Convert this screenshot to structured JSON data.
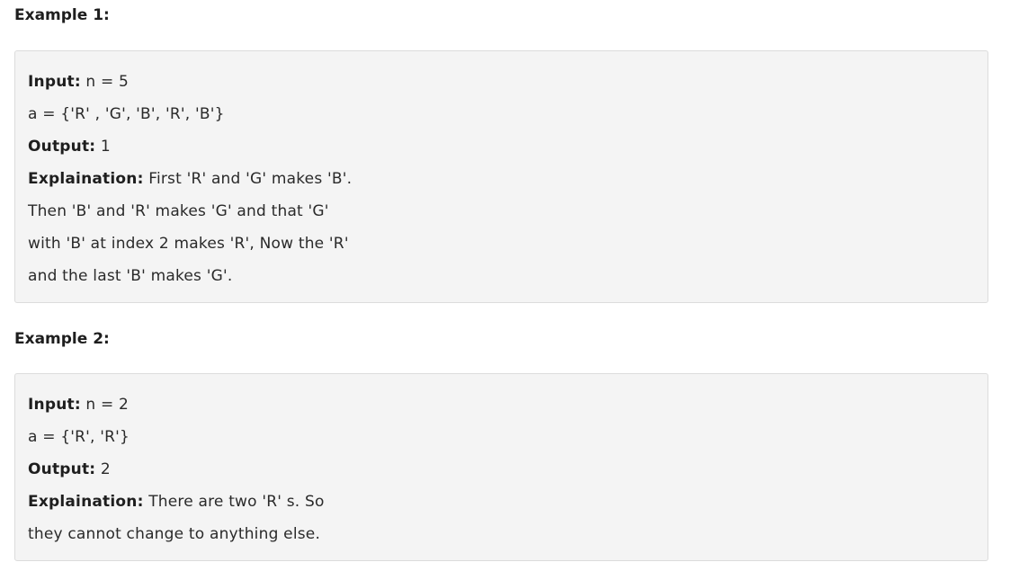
{
  "examples": [
    {
      "heading": "Example 1:",
      "input_label": "Input:",
      "input_value": " n = 5",
      "array_line": "a = {'R' , 'G', 'B', 'R', 'B'}",
      "output_label": "Output:",
      "output_value": " 1",
      "explanation_label": "Explaination:",
      "explanation_lines": [
        " First 'R' and 'G' makes 'B'.",
        "Then 'B' and 'R' makes 'G' and that 'G'",
        "with 'B' at index 2 makes 'R', Now the 'R'",
        "and the last 'B' makes 'G'."
      ]
    },
    {
      "heading": "Example 2:",
      "input_label": "Input:",
      "input_value": " n = 2",
      "array_line": "a = {'R', 'R'}",
      "output_label": "Output:",
      "output_value": " 2",
      "explanation_label": "Explaination:",
      "explanation_lines": [
        " There are two 'R' s. So",
        "they cannot change to anything else."
      ]
    }
  ]
}
